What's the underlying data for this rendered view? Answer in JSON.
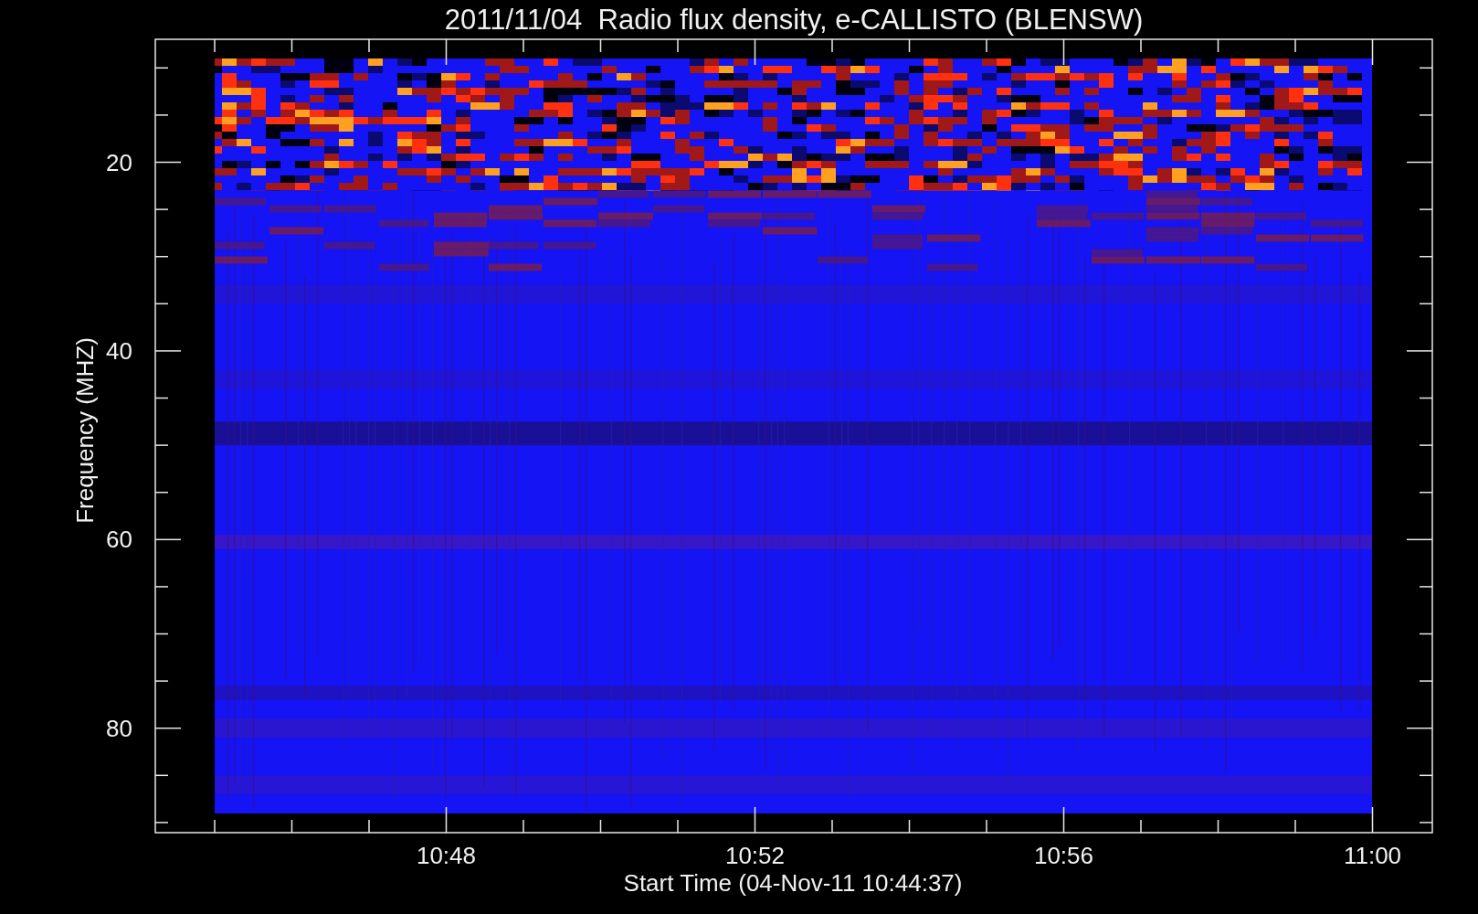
{
  "title": "2011/11/04  Radio flux density, e-CALLISTO (BLENSW)",
  "y_axis": {
    "label": "Frequency (MHZ)",
    "ticks": [
      "20",
      "40",
      "60",
      "80"
    ]
  },
  "x_axis": {
    "label": "Start Time (04-Nov-11 10:44:37)",
    "ticks": [
      "10:48",
      "10:52",
      "10:56",
      "11:00"
    ]
  }
}
